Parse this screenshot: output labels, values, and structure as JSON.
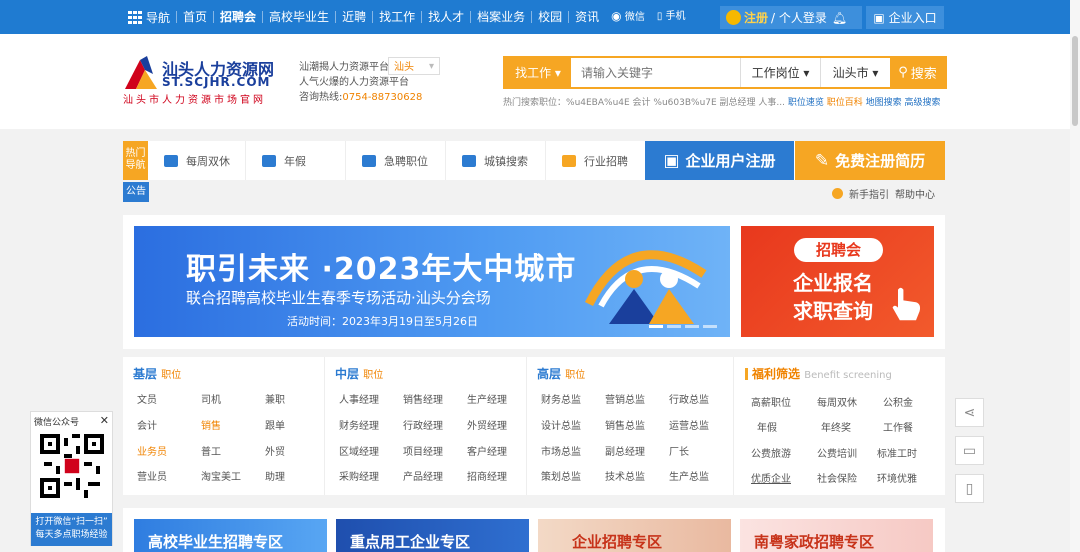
{
  "topnav": {
    "items": [
      "导航",
      "首页",
      "招聘会",
      "高校毕业生",
      "近聘",
      "找工作",
      "找人才",
      "档案业务",
      "校园",
      "资讯",
      "微信",
      "手机"
    ],
    "login_register": "注册",
    "login_personal": "/ 个人登录",
    "corp_entry": "企业入口"
  },
  "header": {
    "logo_name": "汕头人力资源网",
    "logo_domain": "ST.SCJHR.COM",
    "logo_slogan": "汕头市人力资源市场官网",
    "platform_line": "汕潮揭人力资源平台",
    "city": "汕头",
    "tagline_prefix": "人气火爆的",
    "tagline_hot": "人力资源平台",
    "hotline_label": "咨询热线:",
    "hotline": "0754-88730628"
  },
  "search": {
    "type": "找工作",
    "placeholder": "请输入关键字",
    "position": "工作岗位",
    "city": "汕头市",
    "button": "搜索",
    "hot_label": "热门搜索职位：",
    "hot_words": "%u4EBA%u4E 会计 %u603B%u7E 副总经理 人事...",
    "links": [
      "职位速览",
      "职位百科",
      "地图搜索",
      "高级搜索"
    ]
  },
  "quick": {
    "hot_label": "热门导航",
    "items": [
      "每周双休",
      "年假",
      "急聘职位",
      "城镇搜索",
      "行业招聘"
    ],
    "corp_register": "企业用户注册",
    "resume_register": "免费注册简历"
  },
  "notice": {
    "label": "公告",
    "guide": "新手指引",
    "help": "帮助中心"
  },
  "banner": {
    "title": "职引未来 ·2023年大中城市",
    "subtitle": "联合招聘高校毕业生春季专场活动·汕头分会场",
    "time": "活动时间：2023年3月19日至5月26日",
    "side_tag": "招聘会",
    "side_line1": "企业报名",
    "side_line2": "求职查询"
  },
  "categories": {
    "basic": {
      "title": "基层",
      "sub": "职位",
      "items": [
        "文员",
        "司机",
        "兼职",
        "会计",
        "销售",
        "跟单",
        "业务员",
        "普工",
        "外贸",
        "营业员",
        "淘宝美工",
        "助理"
      ]
    },
    "middle": {
      "title": "中层",
      "sub": "职位",
      "items": [
        "人事经理",
        "销售经理",
        "生产经理",
        "财务经理",
        "行政经理",
        "外贸经理",
        "区域经理",
        "项目经理",
        "客户经理",
        "采购经理",
        "产品经理",
        "招商经理"
      ]
    },
    "senior": {
      "title": "高层",
      "sub": "职位",
      "items": [
        "财务总监",
        "营销总监",
        "行政总监",
        "设计总监",
        "销售总监",
        "运营总监",
        "市场总监",
        "副总经理",
        "厂长",
        "策划总监",
        "技术总监",
        "生产总监"
      ]
    },
    "welfare": {
      "title": "福利筛选",
      "sub": "Benefit screening",
      "items": [
        "高薪职位",
        "每周双休",
        "公积金",
        "年假",
        "年终奖",
        "工作餐",
        "公费旅游",
        "公费培训",
        "标准工时",
        "优质企业",
        "社会保险",
        "环境优雅"
      ]
    }
  },
  "promos": [
    "高校毕业生招聘专区",
    "重点用工企业专区",
    "企业招聘专区",
    "南粤家政招聘专区"
  ],
  "wechat": {
    "title": "微信公众号",
    "close": "✕",
    "caption1": "打开微信“扫一扫”",
    "caption2": "每天多点职场经验"
  },
  "colors": {
    "primary": "#1f7bd1",
    "accent": "#f6a623",
    "red": "#e8381d"
  }
}
